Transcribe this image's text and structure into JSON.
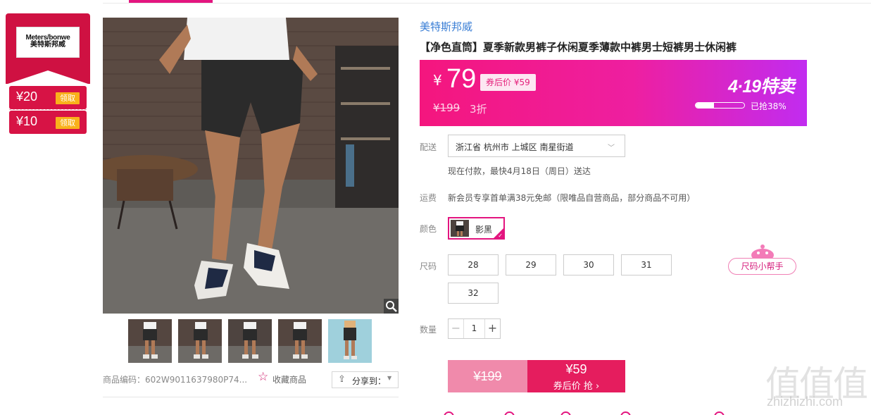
{
  "brand": {
    "logo_en": "Meters/bonwe",
    "logo_cn": "美特斯邦威"
  },
  "coupons": [
    {
      "amount": "¥20",
      "action": "领取"
    },
    {
      "amount": "¥10",
      "action": "领取"
    }
  ],
  "gallery": {
    "thumb_count": 5
  },
  "product": {
    "brand_link": "美特斯邦威",
    "title": "【净色直筒】夏季新款男裤子休闲夏季薄款中裤男士短裤男士休闲裤",
    "sku_code": "商品编码：602W9011637980P74...",
    "favorite_label": "收藏商品",
    "share_label": "分享到："
  },
  "price_banner": {
    "currency": "¥",
    "price": "79",
    "after_coupon": "券后价 ¥59",
    "original_price": "¥199",
    "discount": "3折",
    "promo": "4·19特卖",
    "sold_fraction": 0.38,
    "sold_label": "已抢38%"
  },
  "delivery": {
    "label": "配送",
    "address": "浙江省 杭州市 上城区 南星街道",
    "note": "现在付款，最快4月18日（周日）送达"
  },
  "shipping": {
    "label": "运费",
    "note": "新会员专享首单满38元免邮（限唯品自营商品，部分商品不可用）"
  },
  "color": {
    "label": "颜色",
    "selected": "影黑"
  },
  "size": {
    "label": "尺码",
    "options": [
      "28",
      "29",
      "30",
      "31",
      "32"
    ],
    "helper": "尺码小帮手"
  },
  "quantity": {
    "label": "数量",
    "minus": "−",
    "value": "1",
    "plus": "+"
  },
  "buy": {
    "original": "¥199",
    "price": "¥59",
    "sub": "券后价 抢 ›"
  },
  "watermark": {
    "glyphs": "值值值",
    "site": "zhizhizhi.com"
  },
  "colors": {
    "accent": "#e3157f",
    "coupon_red": "#cf1142",
    "coupon_btn": "#f9b11b",
    "link_blue": "#3a7ed5",
    "buy_light": "#f08aab",
    "buy_dark": "#e51d5e"
  }
}
